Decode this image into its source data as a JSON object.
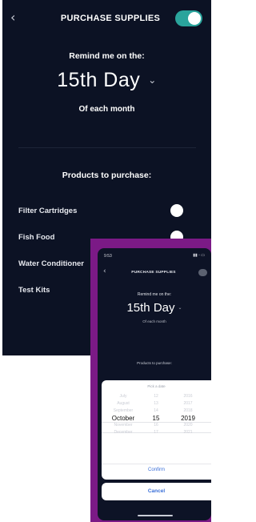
{
  "main": {
    "back_icon": "chevron-left",
    "title": "PURCHASE SUPPLIES",
    "enabled": true,
    "remind_label": "Remind me on the:",
    "day_value": "15th Day",
    "each_month": "Of each month",
    "products_heading": "Products to purchase:",
    "products": [
      {
        "label": "Filter Cartridges",
        "enabled": false
      },
      {
        "label": "Fish Food",
        "enabled": false
      },
      {
        "label": "Water Conditioner",
        "enabled": false
      },
      {
        "label": "Test Kits",
        "enabled": false
      }
    ]
  },
  "phone": {
    "time": "9:53",
    "title": "PURCHASE SUPPLIES",
    "remind_label": "Remind me on the:",
    "day_value": "15th Day",
    "each_month": "Of each month",
    "products_heading": "Products to purchase:",
    "picker": {
      "title": "Pick a date",
      "months": [
        "July",
        "August",
        "September",
        "October",
        "November",
        "December"
      ],
      "days": [
        "12",
        "13",
        "14",
        "15",
        "16",
        "17"
      ],
      "years": [
        "2016",
        "2017",
        "2018",
        "2019",
        "2020",
        "2021"
      ],
      "selected": {
        "month": "October",
        "day": "15",
        "year": "2019"
      },
      "confirm": "Confirm",
      "cancel": "Cancel"
    }
  },
  "colors": {
    "background": "#0c1224",
    "toggle_on": "#2aa49c",
    "frame": "#7b1a86",
    "link": "#3a6fd8"
  }
}
